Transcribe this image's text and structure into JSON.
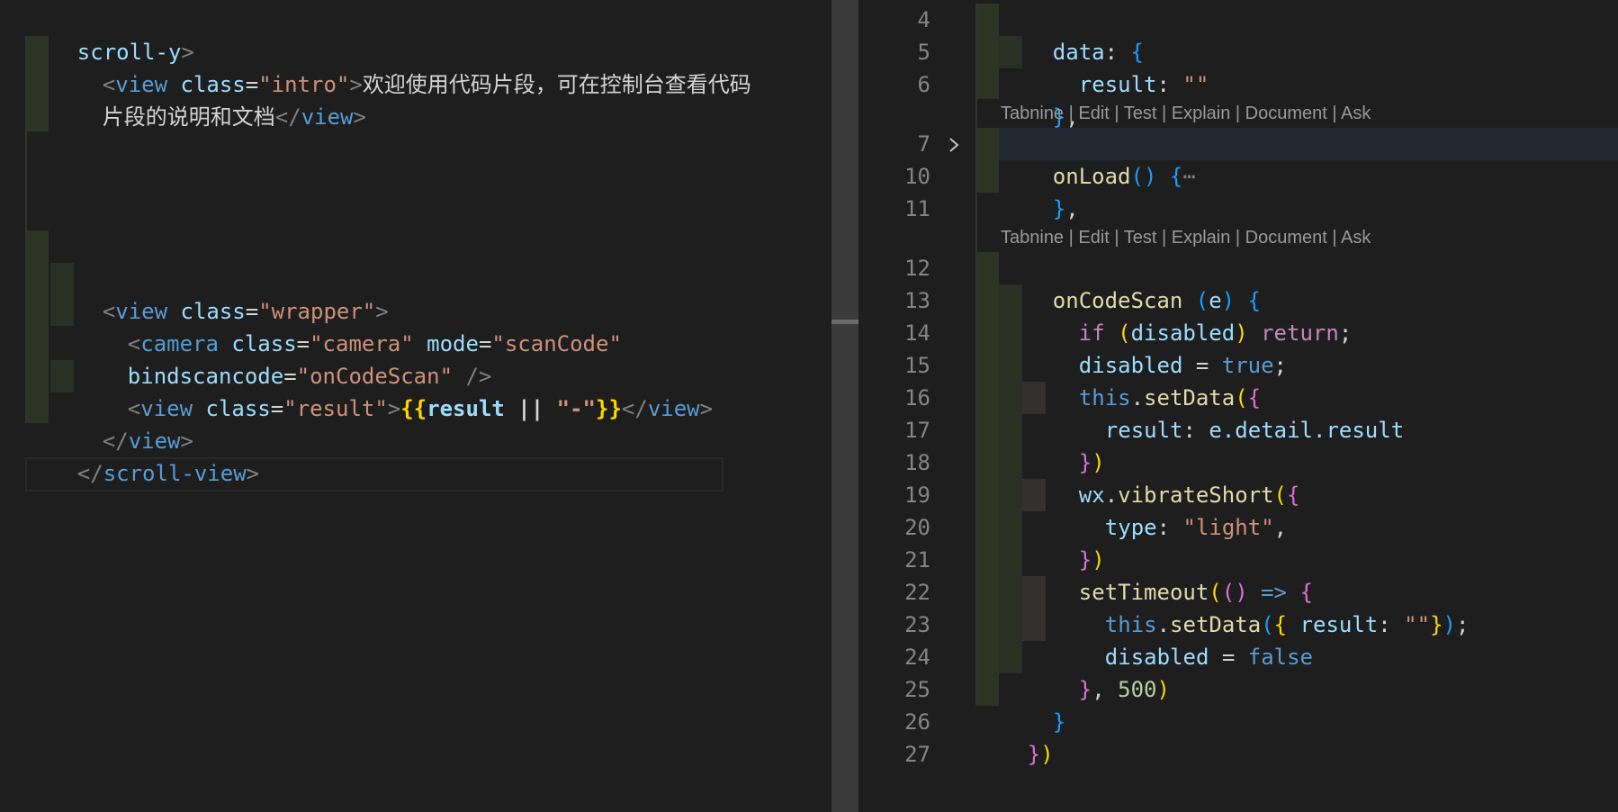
{
  "left": {
    "lines": {
      "l0": "scroll-y",
      "l0_close": ">",
      "l1_open": "<",
      "l1_tag": "view",
      "l1_attr": "class",
      "l1_eq": "=",
      "l1_val": "\"intro\"",
      "l1_gt": ">",
      "l1_text": "欢迎使用代码片段，可在控制台查看代码",
      "l2_text": "片段的说明和文档",
      "l2_close_open": "</",
      "l2_tag": "view",
      "l2_gt": ">",
      "l3_open": "<",
      "l3_tag": "view",
      "l3_attr": "class",
      "l3_eq": "=",
      "l3_val": "\"wrapper\"",
      "l3_gt": ">",
      "l4_open": "<",
      "l4_tag": "camera",
      "l4_attr1": "class",
      "l4_eq1": "=",
      "l4_val1": "\"camera\"",
      "l4_attr2": "mode",
      "l4_eq2": "=",
      "l4_val2": "\"scanCode\"",
      "l5_attr": "bindscancode",
      "l5_eq": "=",
      "l5_val": "\"onCodeScan\"",
      "l5_close": " />",
      "l6_open": "<",
      "l6_tag": "view",
      "l6_attr": "class",
      "l6_eq": "=",
      "l6_val": "\"result\"",
      "l6_gt": ">",
      "l6_mus_open": "{{",
      "l6_var": "result",
      "l6_op": " || ",
      "l6_str": "\"-\"",
      "l6_mus_close": "}}",
      "l6_close_open": "</",
      "l6_close_tag": "view",
      "l6_close_gt": ">",
      "l7_open": "</",
      "l7_tag": "view",
      "l7_gt": ">",
      "l8_open": "</",
      "l8_tag": "scroll-view",
      "l8_gt": ">"
    }
  },
  "right": {
    "line_numbers": [
      "4",
      "5",
      "6",
      "7",
      "10",
      "11",
      "12",
      "13",
      "14",
      "15",
      "16",
      "17",
      "18",
      "19",
      "20",
      "21",
      "22",
      "23",
      "24",
      "25",
      "26",
      "27"
    ],
    "codelens": "Tabnine | Edit | Test | Explain | Document | Ask",
    "code": {
      "r4_key": "data",
      "r4_colon": ": ",
      "r4_brace": "{",
      "r5_key": "result",
      "r5_colon": ": ",
      "r5_val": "\"\"",
      "r6_brace": "}",
      "r6_comma": ",",
      "r7_fn": "onLoad",
      "r7_parens": "()",
      "r7_brace": " {",
      "r7_ellipsis": "⋯",
      "r10_brace": "}",
      "r10_comma": ",",
      "r12_fn": "onCodeScan",
      "r12_paren_open": " (",
      "r12_param": "e",
      "r12_paren_close": ")",
      "r12_brace": " {",
      "r13_kw": "if",
      "r13_paren_open": " (",
      "r13_var": "disabled",
      "r13_paren_close": ")",
      "r13_ret": " return",
      "r13_semi": ";",
      "r14_var": "disabled",
      "r14_eq": " = ",
      "r14_val": "true",
      "r14_semi": ";",
      "r15_this": "this",
      "r15_dot": ".",
      "r15_fn": "setData",
      "r15_paren": "(",
      "r15_brace": "{",
      "r16_key": "result",
      "r16_colon": ": ",
      "r16_val": "e.detail.result",
      "r17_brace": "}",
      "r17_paren": ")",
      "r18_obj": "wx",
      "r18_dot": ".",
      "r18_fn": "vibrateShort",
      "r18_paren": "(",
      "r18_brace": "{",
      "r19_key": "type",
      "r19_colon": ": ",
      "r19_val": "\"light\"",
      "r19_comma": ",",
      "r20_brace": "}",
      "r20_paren": ")",
      "r21_fn": "setTimeout",
      "r21_paren": "(",
      "r21_parens": "()",
      "r21_arrow": " => ",
      "r21_brace": "{",
      "r22_this": "this",
      "r22_dot": ".",
      "r22_fn": "setData",
      "r22_paren": "(",
      "r22_brace_open": "{",
      "r22_key": " result",
      "r22_colon": ": ",
      "r22_val": "\"\"",
      "r22_brace_close": "}",
      "r22_paren_close": ")",
      "r22_semi": ";",
      "r23_var": "disabled",
      "r23_eq": " = ",
      "r23_val": "false",
      "r24_brace": "}",
      "r24_comma": ", ",
      "r24_num": "500",
      "r24_paren": ")",
      "r25_brace": "}",
      "r26_brace": "}",
      "r26_paren": ")"
    }
  },
  "colors": {
    "background": "#1e1e1e",
    "tag": "#569cd6",
    "attribute": "#9cdcfe",
    "string": "#ce9178",
    "function": "#dcdcaa",
    "keyword": "#c586c0"
  }
}
